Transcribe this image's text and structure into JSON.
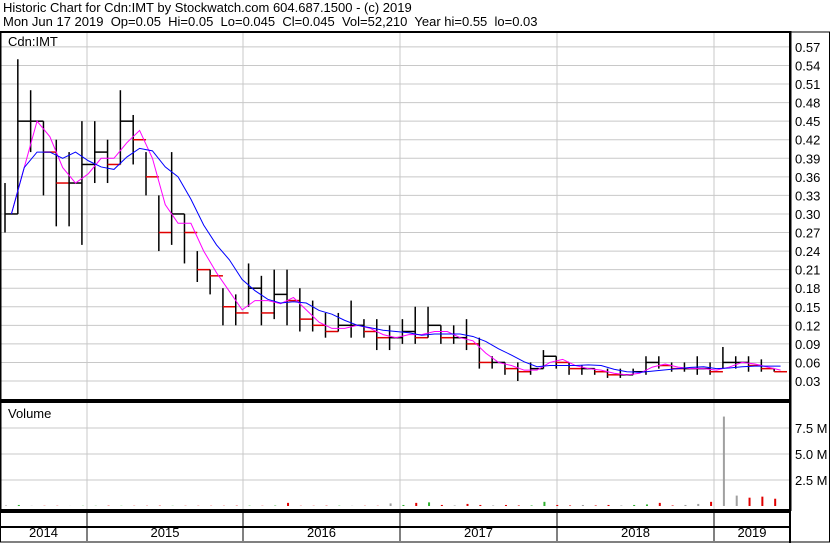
{
  "header": {
    "title": "Historic Chart for Cdn:IMT by Stockwatch.com 604.687.1500 - (c) 2019",
    "quote": "Mon Jun 17 2019  Op=0.05  Hi=0.05  Lo=0.045  Cl=0.045  Vol=52,210  Year hi=0.55  lo=0.03"
  },
  "chart_data": [
    {
      "type": "bar",
      "title": "Cdn:IMT",
      "subtype": "ohlc-monthly-approx",
      "ylim": [
        0.0,
        0.59
      ],
      "yticks": [
        "0.57",
        "0.54",
        "0.51",
        "0.48",
        "0.45",
        "0.42",
        "0.39",
        "0.36",
        "0.33",
        "0.30",
        "0.27",
        "0.24",
        "0.21",
        "0.18",
        "0.15",
        "0.12",
        "0.09",
        "0.06",
        "0.03"
      ],
      "x_labels": [
        "2014",
        "2015",
        "2016",
        "2017",
        "2018",
        "2019"
      ],
      "start_month": "2014-06",
      "high": [
        0.35,
        0.55,
        0.5,
        0.45,
        0.42,
        0.4,
        0.45,
        0.45,
        0.42,
        0.5,
        0.46,
        0.4,
        0.33,
        0.4,
        0.3,
        0.24,
        0.21,
        0.18,
        0.17,
        0.22,
        0.2,
        0.21,
        0.21,
        0.18,
        0.16,
        0.14,
        0.14,
        0.16,
        0.13,
        0.13,
        0.12,
        0.13,
        0.15,
        0.15,
        0.12,
        0.12,
        0.13,
        0.1,
        0.07,
        0.06,
        0.06,
        0.06,
        0.08,
        0.07,
        0.06,
        0.055,
        0.05,
        0.05,
        0.05,
        0.05,
        0.07,
        0.07,
        0.06,
        0.06,
        0.07,
        0.06,
        0.085,
        0.07,
        0.07,
        0.065,
        0.05
      ],
      "low": [
        0.27,
        0.3,
        0.4,
        0.33,
        0.28,
        0.28,
        0.25,
        0.35,
        0.35,
        0.38,
        0.38,
        0.33,
        0.24,
        0.25,
        0.22,
        0.19,
        0.17,
        0.12,
        0.12,
        0.15,
        0.12,
        0.13,
        0.12,
        0.11,
        0.11,
        0.1,
        0.11,
        0.1,
        0.1,
        0.08,
        0.08,
        0.09,
        0.09,
        0.1,
        0.09,
        0.09,
        0.08,
        0.05,
        0.05,
        0.04,
        0.03,
        0.04,
        0.05,
        0.05,
        0.04,
        0.04,
        0.04,
        0.035,
        0.035,
        0.04,
        0.04,
        0.05,
        0.045,
        0.045,
        0.04,
        0.04,
        0.05,
        0.05,
        0.045,
        0.045,
        0.045
      ],
      "close": [
        0.3,
        0.45,
        0.45,
        0.4,
        0.35,
        0.35,
        0.38,
        0.4,
        0.38,
        0.45,
        0.42,
        0.36,
        0.27,
        0.3,
        0.27,
        0.21,
        0.2,
        0.15,
        0.14,
        0.18,
        0.14,
        0.17,
        0.16,
        0.13,
        0.12,
        0.11,
        0.12,
        0.12,
        0.11,
        0.1,
        0.1,
        0.11,
        0.1,
        0.12,
        0.1,
        0.1,
        0.09,
        0.06,
        0.06,
        0.05,
        0.045,
        0.05,
        0.07,
        0.06,
        0.05,
        0.05,
        0.045,
        0.04,
        0.04,
        0.045,
        0.06,
        0.055,
        0.05,
        0.05,
        0.05,
        0.045,
        0.06,
        0.06,
        0.055,
        0.05,
        0.045
      ],
      "series": [
        {
          "name": "Short moving average",
          "color": "#ff00ff"
        },
        {
          "name": "Long moving average",
          "color": "#0000ff"
        }
      ],
      "grid": true
    },
    {
      "type": "bar",
      "title": "Volume",
      "yticks": [
        "7.5 M",
        "5.0 M",
        "2.5 M"
      ],
      "ylim": [
        0,
        9.5
      ],
      "values_m": [
        0.05,
        0.1,
        0.02,
        0.02,
        0.02,
        0.01,
        0.02,
        0.02,
        0.03,
        0.02,
        0.02,
        0.02,
        0.03,
        0.02,
        0.02,
        0.02,
        0.02,
        0.02,
        0.03,
        0.03,
        0.02,
        0.04,
        0.3,
        0.02,
        0.02,
        0.03,
        0.03,
        0.02,
        0.02,
        0.02,
        0.25,
        0.1,
        0.3,
        0.35,
        0.1,
        0.05,
        0.2,
        0.1,
        0.05,
        0.1,
        0.05,
        0.05,
        0.4,
        0.1,
        0.05,
        0.1,
        0.05,
        0.1,
        0.05,
        0.1,
        0.15,
        0.3,
        0.05,
        0.1,
        0.2,
        0.4,
        8.6,
        1.0,
        0.8,
        0.9,
        0.7
      ]
    }
  ]
}
